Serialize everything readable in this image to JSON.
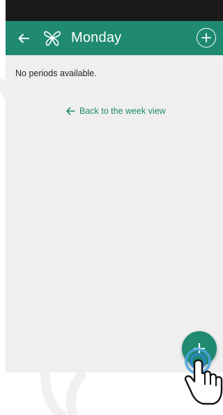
{
  "app_bar": {
    "title": "Monday",
    "back_icon": "arrow-left-icon",
    "logo_icon": "butterfly-logo-icon",
    "add_icon": "plus-circle-icon",
    "color": "#1f8a70"
  },
  "content": {
    "empty_message": "No periods available.",
    "back_link_label": "Back to the week view",
    "back_link_icon": "arrow-left-icon"
  },
  "fab": {
    "icon": "plus-icon",
    "color": "#1f8a70"
  },
  "colors": {
    "status_bar": "#1a1a1a",
    "background": "#efefef",
    "accent": "#1f8a70"
  }
}
